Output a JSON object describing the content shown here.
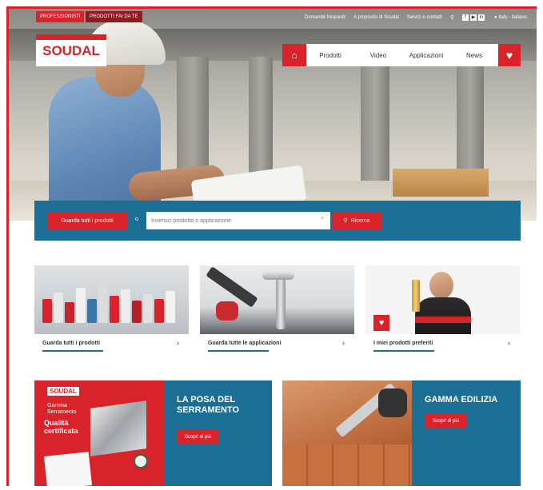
{
  "topbar": {
    "tab_active": "PROFESSIONISTI",
    "tab_other": "PRODOTTI FAI DA TE",
    "links": [
      "Domande frequenti",
      "A proposito di Soudal",
      "Servizi e contatti"
    ],
    "language": "Italy - Italiano"
  },
  "logo": {
    "text": "SOUDAL"
  },
  "nav": {
    "items": [
      "Prodotti",
      "Video",
      "Applicazioni",
      "News"
    ]
  },
  "search": {
    "all_products_label": "Guarda tutti i prodotti",
    "or_label": "o",
    "placeholder": "Inserisci prodotto o applicazione",
    "clear": "×",
    "search_label": "Ricerca"
  },
  "cards": [
    {
      "label": "Guarda tutti i prodotti"
    },
    {
      "label": "Guarda tutte le applicazioni"
    },
    {
      "label": "I miei prodotti preferiti"
    }
  ],
  "promos": [
    {
      "title": "LA POSA DEL SERRAMENTO",
      "button": "Scopri di più",
      "image_logo": "SOUDAL",
      "image_text_1": "Gamma Serramento",
      "image_text_2": "Qualità certificata"
    },
    {
      "title": "GAMMA EDILIZIA",
      "button": "Scopri di più"
    }
  ],
  "colors": {
    "brand_red": "#d8232a",
    "brand_blue": "#1b6f94"
  },
  "icons": [
    "home-icon",
    "heart-icon",
    "search-icon",
    "facebook-icon",
    "youtube-icon",
    "linkedin-icon",
    "chevron-right-icon"
  ]
}
